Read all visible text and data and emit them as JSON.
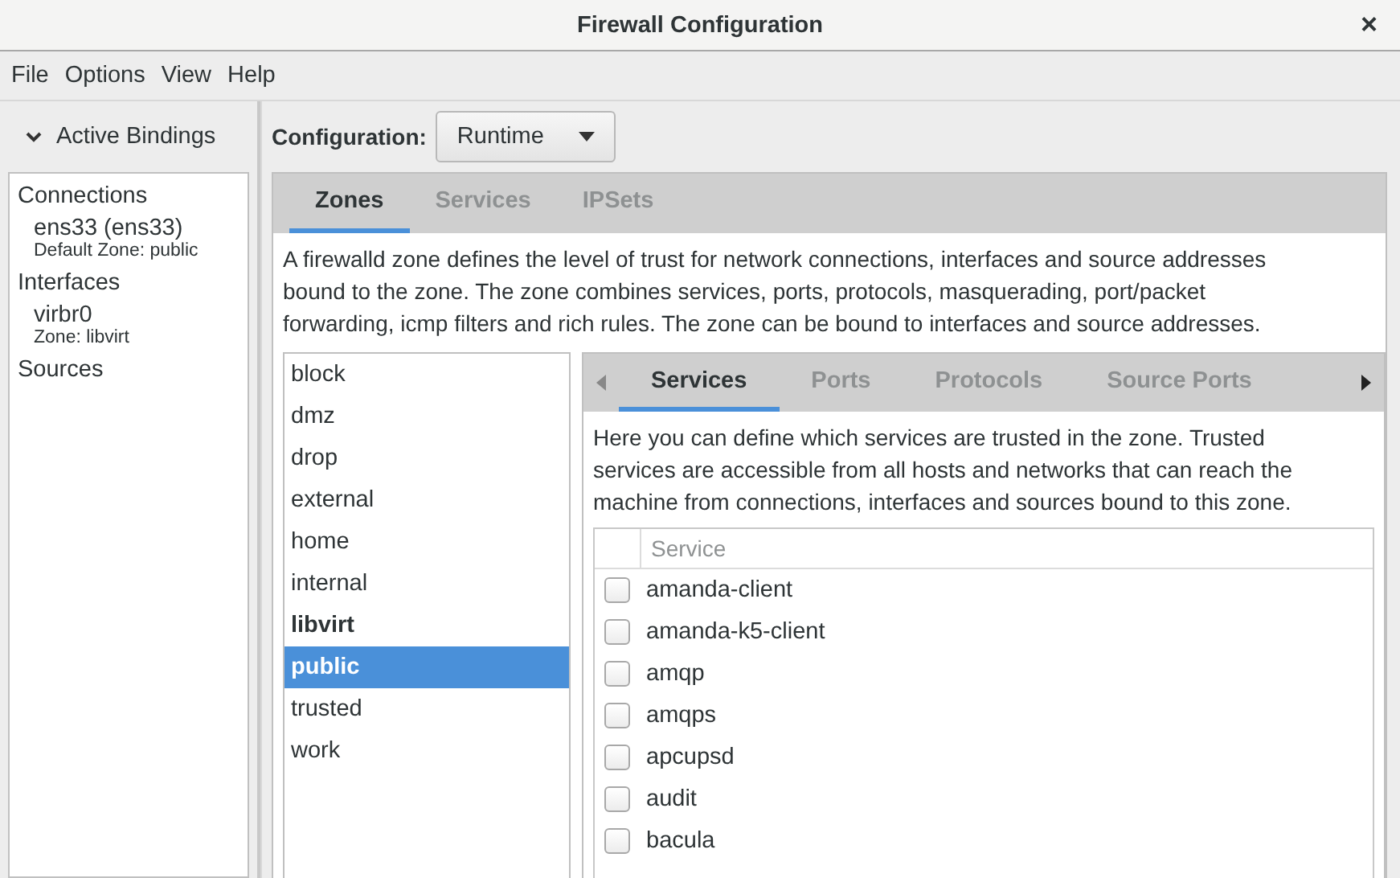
{
  "window": {
    "title": "Firewall Configuration",
    "close": "×"
  },
  "menu": [
    "File",
    "Options",
    "View",
    "Help"
  ],
  "sidebar": {
    "header": "Active Bindings",
    "expanded": true,
    "groups": [
      {
        "title": "Connections",
        "items": [
          {
            "name": "ens33 (ens33)",
            "detail": "Default Zone: public"
          }
        ]
      },
      {
        "title": "Interfaces",
        "items": [
          {
            "name": "virbr0",
            "detail": "Zone: libvirt"
          }
        ]
      },
      {
        "title": "Sources"
      }
    ]
  },
  "configuration": {
    "label": "Configuration:",
    "value": "Runtime"
  },
  "tabs": [
    {
      "label": "Zones",
      "selected": true
    },
    {
      "label": "Services",
      "selected": false
    },
    {
      "label": "IPSets",
      "selected": false
    }
  ],
  "description": "A firewalld zone defines the level of trust for network connections, interfaces and source addresses bound to the zone. The zone combines services, ports, protocols, masquerading, port/packet forwarding, icmp filters and rich rules. The zone can be bound to interfaces and source addresses.",
  "zones": [
    {
      "name": "block",
      "active": false,
      "selected": false
    },
    {
      "name": "dmz",
      "active": false,
      "selected": false
    },
    {
      "name": "drop",
      "active": false,
      "selected": false
    },
    {
      "name": "external",
      "active": false,
      "selected": false
    },
    {
      "name": "home",
      "active": false,
      "selected": false
    },
    {
      "name": "internal",
      "active": false,
      "selected": false
    },
    {
      "name": "libvirt",
      "active": true,
      "selected": false
    },
    {
      "name": "public",
      "active": true,
      "selected": true
    },
    {
      "name": "trusted",
      "active": false,
      "selected": false
    },
    {
      "name": "work",
      "active": false,
      "selected": false
    }
  ],
  "zone_tabs": [
    {
      "label": "Services",
      "selected": true
    },
    {
      "label": "Ports",
      "selected": false
    },
    {
      "label": "Protocols",
      "selected": false
    },
    {
      "label": "Source Ports",
      "selected": false
    }
  ],
  "services_description": "Here you can define which services are trusted in the zone. Trusted services are accessible from all hosts and networks that can reach the machine from connections, interfaces and sources bound to this zone.",
  "services_table": {
    "columns": [
      "Service"
    ],
    "rows": [
      {
        "name": "amanda-client",
        "checked": false
      },
      {
        "name": "amanda-k5-client",
        "checked": false
      },
      {
        "name": "amqp",
        "checked": false
      },
      {
        "name": "amqps",
        "checked": false
      },
      {
        "name": "apcupsd",
        "checked": false
      },
      {
        "name": "audit",
        "checked": false
      },
      {
        "name": "bacula",
        "checked": false
      }
    ]
  }
}
